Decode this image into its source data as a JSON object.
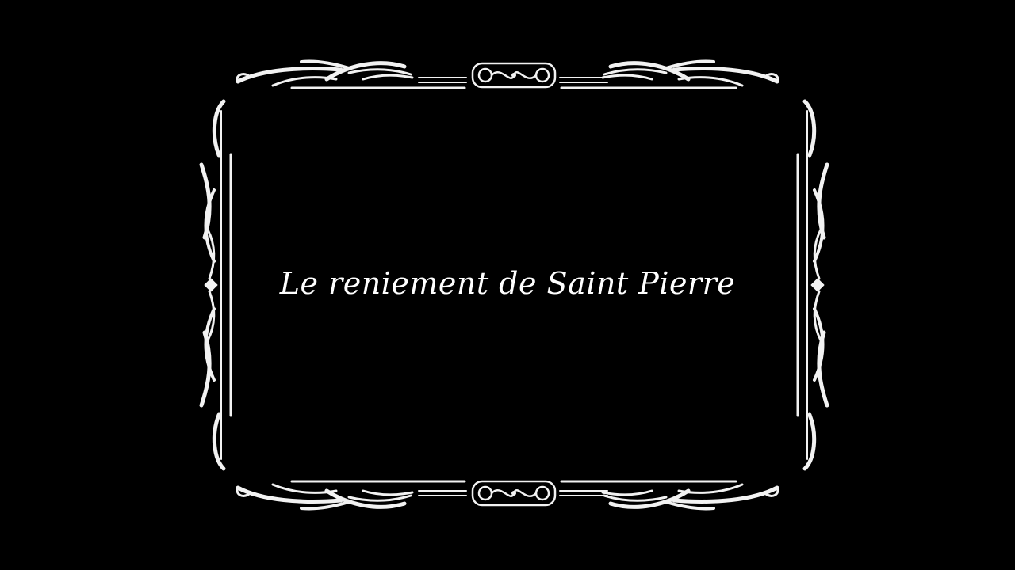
{
  "title_card": {
    "title": "Le reniement de Saint Pierre"
  },
  "colors": {
    "background": "#000000",
    "ornament": "#f2f2f2",
    "text": "#ffffff"
  },
  "icons": {
    "frame": "ornate-frame-icon",
    "center_flourish": "scroll-flourish-icon"
  }
}
